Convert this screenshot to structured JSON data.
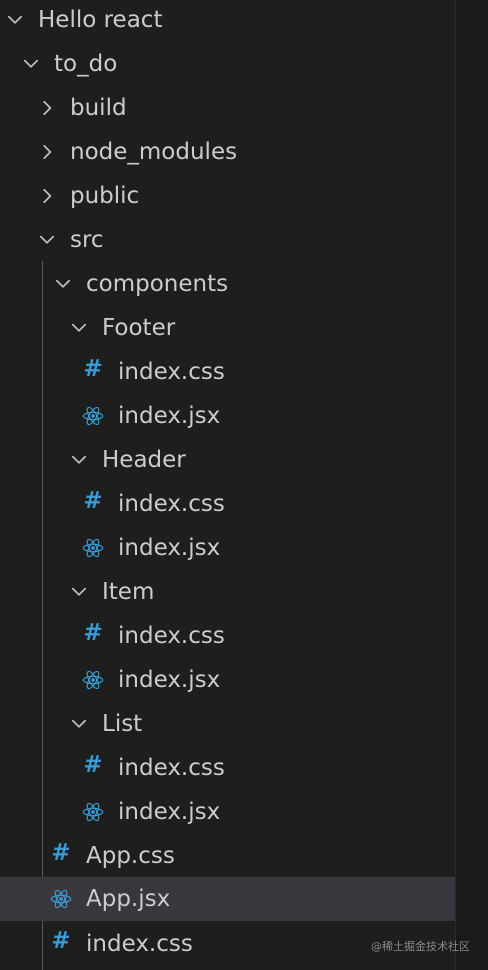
{
  "tree": {
    "root": "Hello react",
    "project": "to_do",
    "build": "build",
    "node_modules": "node_modules",
    "public": "public",
    "src": "src",
    "components": "components",
    "footer": "Footer",
    "footer_css": "index.css",
    "footer_jsx": "index.jsx",
    "header": "Header",
    "header_css": "index.css",
    "header_jsx": "index.jsx",
    "item": "Item",
    "item_css": "index.css",
    "item_jsx": "index.jsx",
    "list": "List",
    "list_css": "index.css",
    "list_jsx": "index.jsx",
    "app_css": "App.css",
    "app_jsx": "App.jsx",
    "index_css": "index.css"
  },
  "icons": {
    "css_icon_glyph": "#",
    "css_icon_color": "#3b9bd4",
    "react_icon_color": "#3b9bd4",
    "chevron_color": "#c5c5c5"
  },
  "selected_item": "App.jsx",
  "watermark": "@稀土掘金技术社区"
}
